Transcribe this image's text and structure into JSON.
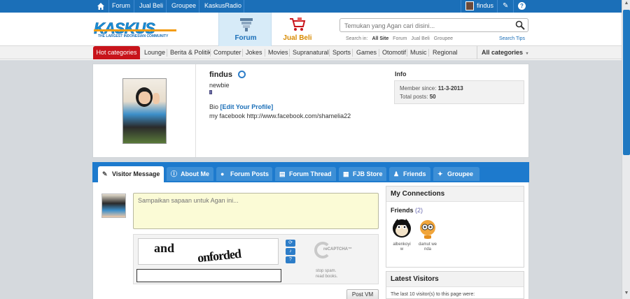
{
  "topbar": {
    "nav": [
      "Forum",
      "Jual Beli",
      "Groupee",
      "KaskusRadio"
    ],
    "username": "findus"
  },
  "header": {
    "logo_text": "KASKUS",
    "logo_tagline": "THE LARGEST INDONESIAN COMMUNITY",
    "tab_forum": "Forum",
    "tab_jualbeli": "Jual Beli",
    "search_placeholder": "Temukan yang Agan cari disini...",
    "search_in_label": "Search in:",
    "search_options": [
      "All Site",
      "Forum",
      "Jual Beli",
      "Groupee"
    ],
    "search_tips": "Search Tips"
  },
  "categories": {
    "hot": "Hot categories",
    "items": [
      "Lounge",
      "Berita & Politik",
      "Computer",
      "Jokes",
      "Movies",
      "Supranatural",
      "Sports",
      "Games",
      "Otomotif",
      "Music",
      "Regional"
    ],
    "all": "All categories"
  },
  "profile": {
    "username": "findus",
    "rank": "newbie",
    "bio_label": "Bio",
    "edit_profile": "[Edit Your Profile]",
    "bio_text": "my facebook http://www.facebook.com/shamelia22",
    "info_title": "Info",
    "member_since_label": "Member since:",
    "member_since": "11-3-2013",
    "total_posts_label": "Total posts:",
    "total_posts": "50"
  },
  "tabs": [
    "Visitor Message",
    "About Me",
    "Forum Posts",
    "Forum Thread",
    "FJB Store",
    "Friends",
    "Groupee"
  ],
  "visitor_message": {
    "placeholder": "Sampaikan sapaan untuk Agan ini...",
    "captcha_word1": "and",
    "captcha_word2": "onforded",
    "recaptcha_label": "reCAPTCHA™",
    "recaptcha_tag1": "stop spam.",
    "recaptcha_tag2": "read books.",
    "post_button": "Post VM"
  },
  "connections": {
    "title": "My Connections",
    "friends_label": "Friends",
    "friends_count": "(2)",
    "friends": [
      {
        "name_line1": "albenkoyi",
        "name_line2": "w"
      },
      {
        "name_line1": "damut we",
        "name_line2": "nda"
      }
    ]
  },
  "latest_visitors": {
    "title": "Latest Visitors",
    "text": "The last 10 visitor(s) to this page were:"
  },
  "colors": {
    "brand_blue": "#1b6fb8",
    "hot_red": "#c8141b",
    "jualbeli_orange": "#d88a00"
  }
}
